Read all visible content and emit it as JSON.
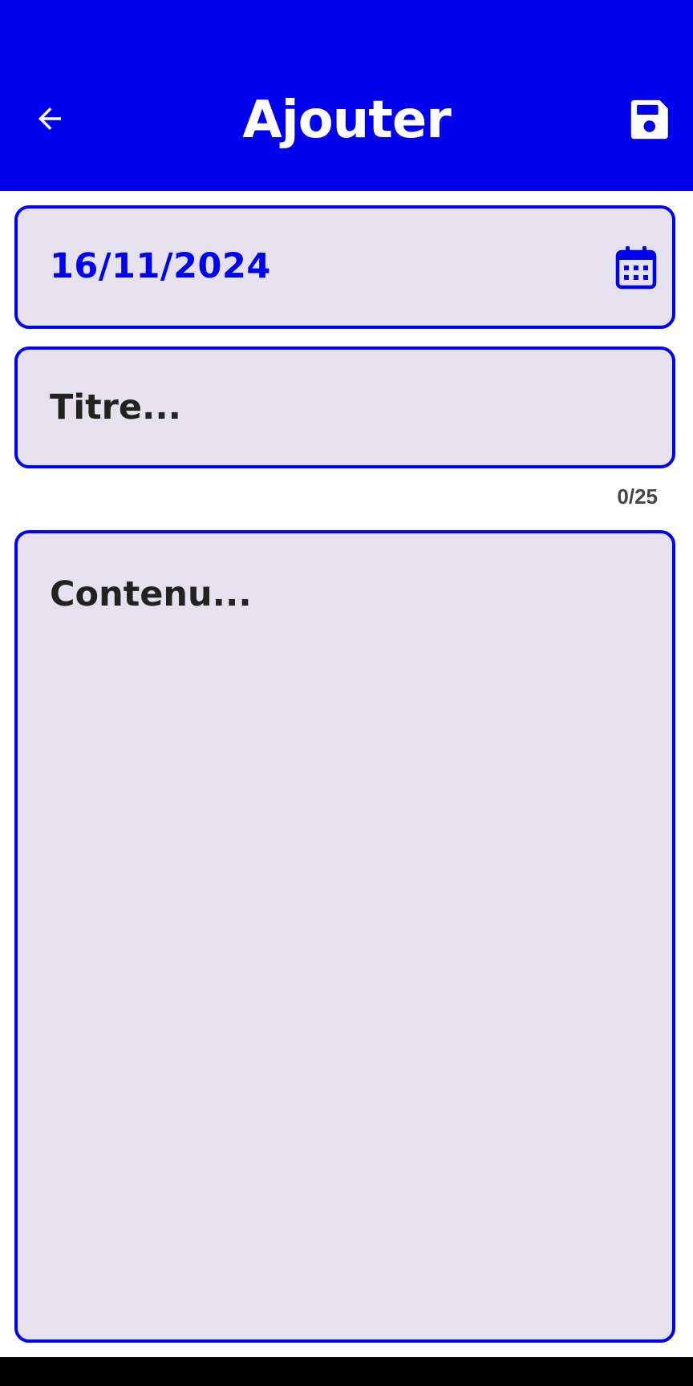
{
  "app_bar": {
    "title": "Ajouter",
    "back_icon": "arrow-left-icon",
    "save_icon": "floppy-disk-icon",
    "color": "#0000ee"
  },
  "form": {
    "date_value": "16/11/2024",
    "date_icon": "calendar-icon",
    "title_placeholder": "Titre...",
    "title_counter": "0/25",
    "content_placeholder": "Contenu...",
    "field_background": "#e6e1ee",
    "field_border": "#0000ee"
  }
}
